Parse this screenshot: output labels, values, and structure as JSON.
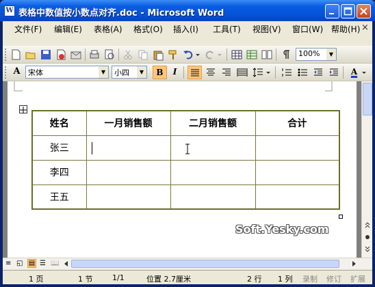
{
  "window": {
    "title": "表格中数值按小数点对齐.doc - Microsoft Word",
    "app_icon": "W"
  },
  "menubar": {
    "items": [
      "文件(F)",
      "编辑(E)",
      "表格(A)",
      "格式(O)",
      "插入(I)",
      "工具(T)",
      "视图(V)",
      "窗口(W)",
      "帮助(H)"
    ],
    "close": "×"
  },
  "toolbar": {
    "zoom": "100%"
  },
  "formatting": {
    "font": "宋体",
    "size": "小四",
    "bold": "B",
    "italic": "I",
    "font_color_label": "A"
  },
  "table": {
    "headers": [
      "姓名",
      "一月销售额",
      "二月销售额",
      "合计"
    ],
    "rows": [
      [
        "张三",
        "",
        "",
        ""
      ],
      [
        "李四",
        "",
        "",
        ""
      ],
      [
        "王五",
        "",
        "",
        ""
      ]
    ]
  },
  "watermark": "Soft.Yesky.com",
  "statusbar": {
    "page": "1 页",
    "section": "1 节",
    "page_of": "1/1",
    "position": "位置 2.7厘米",
    "line": "2 行",
    "column": "1 列",
    "rec": "录制",
    "trk": "修订",
    "ext": "扩展"
  },
  "colors": {
    "table_border": "#6b6b2a",
    "titlebar": "#0a5ce0",
    "active_button": "#ffc67c"
  }
}
